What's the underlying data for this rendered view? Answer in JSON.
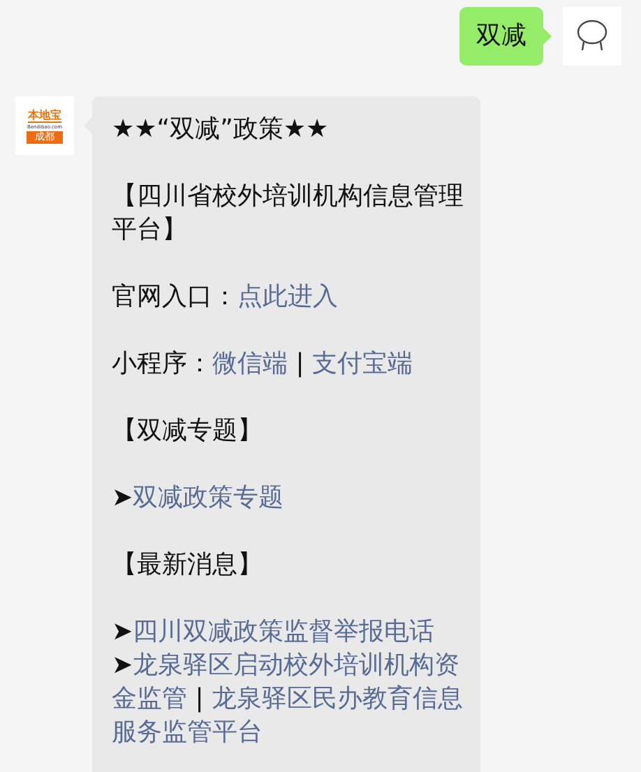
{
  "outgoing": {
    "text": "双减"
  },
  "incoming": {
    "avatar": {
      "brand": "本地宝",
      "domain": "Bendibao.com",
      "city": "成都"
    },
    "blocks": [
      {
        "lines": [
          [
            {
              "kind": "plain",
              "text": "★★“双减”政策★★"
            }
          ]
        ]
      },
      {
        "lines": [
          [
            {
              "kind": "plain",
              "text": "【四川省校外培训机构信息管理"
            }
          ],
          [
            {
              "kind": "plain",
              "text": "平台】"
            }
          ]
        ]
      },
      {
        "lines": [
          [
            {
              "kind": "plain",
              "text": "官网入口："
            },
            {
              "kind": "link",
              "text": "点此进入"
            }
          ]
        ]
      },
      {
        "lines": [
          [
            {
              "kind": "plain",
              "text": "小程序："
            },
            {
              "kind": "link",
              "text": "微信端"
            },
            {
              "kind": "plain",
              "text": " | "
            },
            {
              "kind": "link",
              "text": "支付宝端"
            }
          ]
        ]
      },
      {
        "lines": [
          [
            {
              "kind": "plain",
              "text": "【双减专题】"
            }
          ]
        ]
      },
      {
        "lines": [
          [
            {
              "kind": "arrow",
              "text": "➤"
            },
            {
              "kind": "link",
              "text": "双减政策专题"
            }
          ]
        ]
      },
      {
        "lines": [
          [
            {
              "kind": "plain",
              "text": "【最新消息】"
            }
          ]
        ]
      },
      {
        "lines": [
          [
            {
              "kind": "arrow",
              "text": "➤"
            },
            {
              "kind": "link",
              "text": "四川双减政策监督举报电话"
            }
          ],
          [
            {
              "kind": "arrow",
              "text": "➤"
            },
            {
              "kind": "link",
              "text": "龙泉驿区启动校外培训机构资"
            }
          ],
          [
            {
              "kind": "link",
              "text": "金监管"
            },
            {
              "kind": "plain",
              "text": " | "
            },
            {
              "kind": "link",
              "text": "龙泉驿区民办教育信息"
            }
          ],
          [
            {
              "kind": "link",
              "text": "服务监管平台"
            }
          ]
        ]
      }
    ]
  }
}
